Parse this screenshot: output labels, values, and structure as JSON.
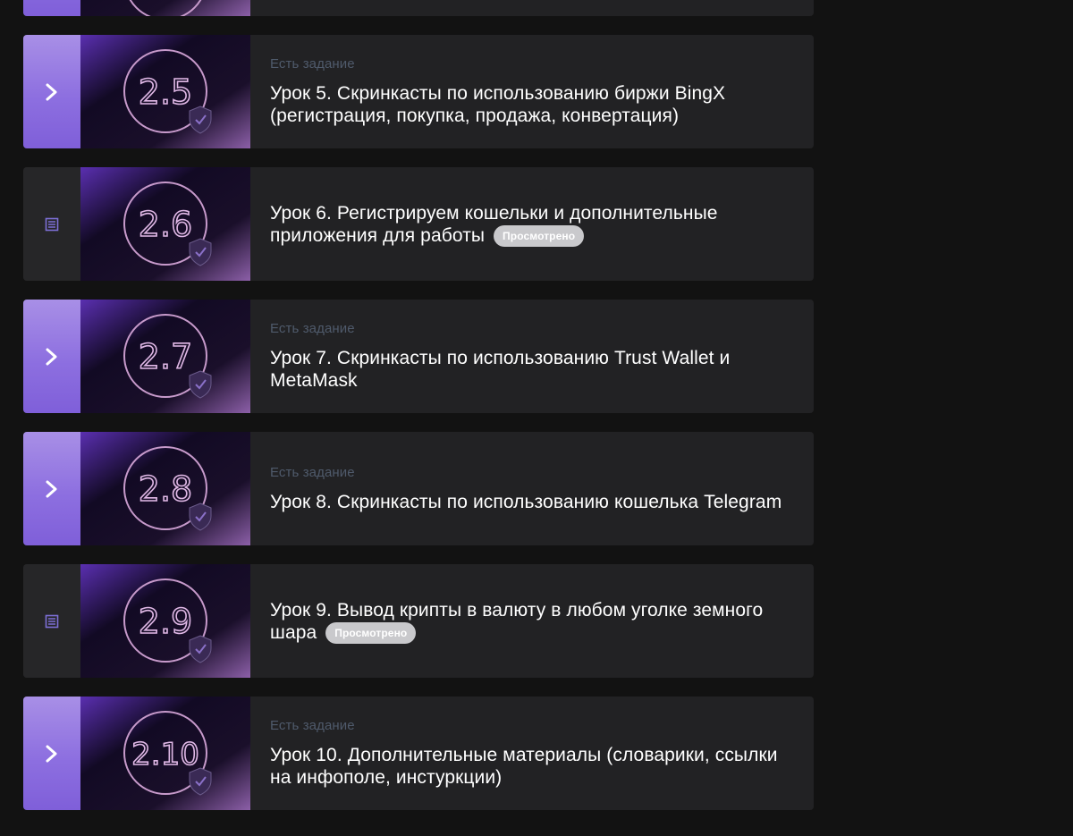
{
  "lessons": [
    {
      "number": "2.5",
      "tag": "Есть задание",
      "title": "Урок 5. Скринкасты по использованию биржи BingX (регистрация, покупка, продажа, конвертация)",
      "badge": "",
      "kind": "task"
    },
    {
      "number": "2.6",
      "tag": "",
      "title": "Урок 6. Регистрируем кошельки и дополнительные приложения для работы",
      "badge": "Просмотрено",
      "kind": "document"
    },
    {
      "number": "2.7",
      "tag": "Есть задание",
      "title": "Урок 7. Скринкасты по использованию Trust Wallet и MetaMask",
      "badge": "",
      "kind": "task"
    },
    {
      "number": "2.8",
      "tag": "Есть задание",
      "title": "Урок 8. Скринкасты по использованию кошелька Telegram",
      "badge": "",
      "kind": "task"
    },
    {
      "number": "2.9",
      "tag": "",
      "title": "Урок 9. Вывод крипты в валюту в любом уголке земного шара",
      "badge": "Просмотрено",
      "kind": "document"
    },
    {
      "number": "2.10",
      "tag": "Есть задание",
      "title": "Урок 10. Дополнительные материалы (словарики, ссылки на инфополе, инстуркции)",
      "badge": "",
      "kind": "task"
    }
  ],
  "icons": {
    "task": "chevron-right-icon",
    "document": "document-icon",
    "thumb_badge": "shield-check-icon"
  },
  "colors": {
    "accent": "#8d6fe0",
    "card": "#222224",
    "background": "#121212",
    "tag": "#4f5a6b",
    "badge": "#c9c9cc"
  }
}
